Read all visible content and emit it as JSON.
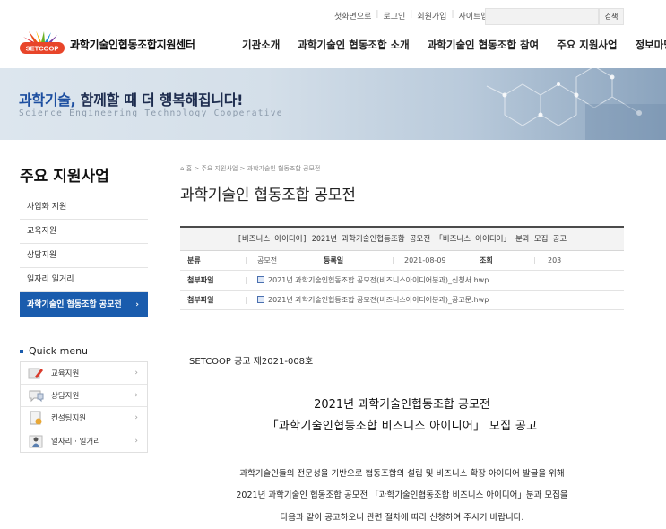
{
  "util": {
    "links": [
      "첫화면으로",
      "로그인",
      "회원가입",
      "사이트맵"
    ],
    "search_button": "검색",
    "search_placeholder": ""
  },
  "logo": {
    "mark_text": "SETCOOP",
    "name": "과학기술인협동조합지원센터"
  },
  "nav": [
    "기관소개",
    "과학기술인 협동조합 소개",
    "과학기술인 협동조합 참여",
    "주요 지원사업",
    "정보마당"
  ],
  "banner": {
    "title_highlight": "과학기술,",
    "title_rest": " 함께할 때 더 행복해집니다!",
    "subtitle": "Science Engineering Technology Cooperative"
  },
  "sidebar": {
    "title": "주요 지원사업",
    "items": [
      {
        "label": "사업화 지원",
        "active": false
      },
      {
        "label": "교육지원",
        "active": false
      },
      {
        "label": "상담지원",
        "active": false
      },
      {
        "label": "일자리 일거리",
        "active": false
      },
      {
        "label": "과학기술인 협동조합 공모전",
        "active": true
      }
    ],
    "active_arrow": "›"
  },
  "quick_menu": {
    "title": "Quick menu",
    "items": [
      {
        "label": "교육지원",
        "icon": "pencil-icon"
      },
      {
        "label": "상담지원",
        "icon": "chat-icon"
      },
      {
        "label": "컨설팅지원",
        "icon": "document-icon"
      },
      {
        "label": "일자리 · 일거리",
        "icon": "person-icon"
      }
    ],
    "arrow": "›"
  },
  "breadcrumb": "홈 > 주요 지원사업 > 과학기술인 협동조합 공모전",
  "page_title": "과학기술인 협동조합 공모전",
  "post": {
    "title": "[비즈니스 아이디어] 2021년 과학기술인협동조합 공모전 「비즈니스 아이디어」 분과 모집 공고",
    "category_label": "분류",
    "category": "공모전",
    "date_label": "등록일",
    "date": "2021-08-09",
    "views_label": "조회",
    "views": "203",
    "attach_label": "첨부파일",
    "files": [
      "2021년 과학기술인협동조합 공모전(비즈니스아이디어분과)_신청서.hwp",
      "2021년 과학기술인협동조합 공모전(비즈니스아이디어분과)_공고문.hwp"
    ]
  },
  "body": {
    "ref": "SETCOOP 공고 제2021-008호",
    "heading1": "2021년 과학기술인협동조합 공모전",
    "heading2": "「과학기술인협동조합 비즈니스 아이디어」 모집 공고",
    "paragraph": [
      "과학기술인들의 전문성을 기반으로 협동조합의 설립 및 비즈니스 확장 아이디어 발굴을 위해",
      "2021년 과학기술인 협동조합 공모전 「과학기술인협동조합 비즈니스 아이디어」분과 모집을",
      "다음과 같이 공고하오니 관련 절차에 따라  신청하여 주시기 바랍니다."
    ]
  },
  "colors": {
    "accent": "#1a5cad",
    "banner_title": "#1c4ea0"
  }
}
